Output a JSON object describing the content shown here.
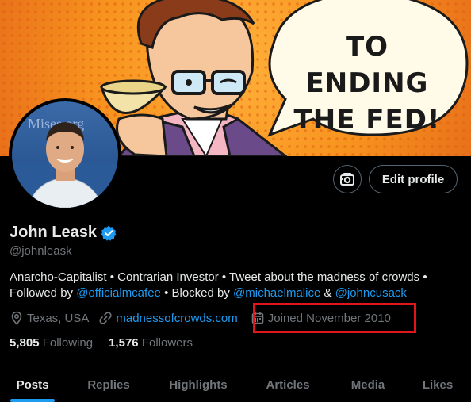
{
  "banner": {
    "bubble_text": "TO ENDING THE FED!"
  },
  "avatar": {
    "background_text": "Mises.org"
  },
  "actions": {
    "edit_profile_label": "Edit profile"
  },
  "profile": {
    "name": "John Leask",
    "handle": "@johnleask",
    "bio_line1": "Anarcho-Capitalist • Contrarian Investor • Tweet about the madness of crowds •",
    "bio_followed_by": "Followed by",
    "bio_followed_handle": "@officialmcafee",
    "bio_blocked_by": "• Blocked by",
    "bio_blocked_handle1": "@michaelmalice",
    "bio_amp": "&",
    "bio_blocked_handle2": "@johncusack",
    "location": "Texas, USA",
    "website": "madnessofcrowds.com",
    "joined": "Joined November 2010",
    "following_count": "5,805",
    "following_label": "Following",
    "followers_count": "1,576",
    "followers_label": "Followers"
  },
  "tabs": [
    "Posts",
    "Replies",
    "Highlights",
    "Articles",
    "Media",
    "Likes"
  ],
  "colors": {
    "accent": "#1d9bf0",
    "highlight_box": "#e0161c",
    "muted": "#71767b"
  },
  "icons": [
    "camera-icon",
    "verified-badge-icon",
    "location-icon",
    "link-icon",
    "calendar-icon"
  ]
}
